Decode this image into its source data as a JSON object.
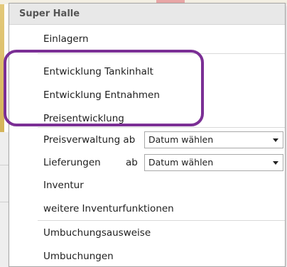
{
  "menu": {
    "title": "Super Halle",
    "items": [
      "Einlagern",
      "Entwicklung Tankinhalt",
      "Entwicklung Entnahmen",
      "Preisentwicklung"
    ],
    "preisverwaltung": {
      "label": "Preisverwaltung ab",
      "combo_value": "Datum wählen"
    },
    "lieferungen": {
      "label": "Lieferungen",
      "ab": "ab",
      "combo_value": "Datum wählen"
    },
    "inventur": "Inventur",
    "weitere_inventur": "weitere Inventurfunktionen",
    "umbuchungsausweise": "Umbuchungsausweise",
    "umbuchungen": "Umbuchungen"
  },
  "annotation": {
    "highlight_color": "#7b2f95"
  }
}
